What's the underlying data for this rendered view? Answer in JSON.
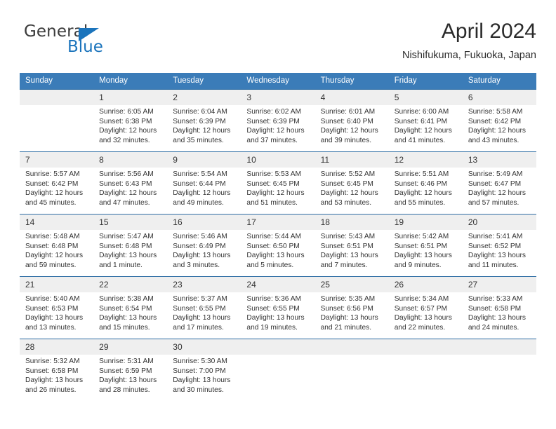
{
  "brand": {
    "name_top": "General",
    "name_bottom": "Blue",
    "accent_color": "#1b74bc"
  },
  "header": {
    "title": "April 2024",
    "location": "Nishifukuma, Fukuoka, Japan"
  },
  "calendar": {
    "header_bg": "#3b7cb8",
    "row_divider": "#2e6da4",
    "daynum_bg": "#efefef",
    "weekday_headers": [
      "Sunday",
      "Monday",
      "Tuesday",
      "Wednesday",
      "Thursday",
      "Friday",
      "Saturday"
    ],
    "weeks": [
      [
        {
          "day": "",
          "empty": true
        },
        {
          "day": "1",
          "sunrise": "Sunrise: 6:05 AM",
          "sunset": "Sunset: 6:38 PM",
          "daylight1": "Daylight: 12 hours",
          "daylight2": "and 32 minutes."
        },
        {
          "day": "2",
          "sunrise": "Sunrise: 6:04 AM",
          "sunset": "Sunset: 6:39 PM",
          "daylight1": "Daylight: 12 hours",
          "daylight2": "and 35 minutes."
        },
        {
          "day": "3",
          "sunrise": "Sunrise: 6:02 AM",
          "sunset": "Sunset: 6:39 PM",
          "daylight1": "Daylight: 12 hours",
          "daylight2": "and 37 minutes."
        },
        {
          "day": "4",
          "sunrise": "Sunrise: 6:01 AM",
          "sunset": "Sunset: 6:40 PM",
          "daylight1": "Daylight: 12 hours",
          "daylight2": "and 39 minutes."
        },
        {
          "day": "5",
          "sunrise": "Sunrise: 6:00 AM",
          "sunset": "Sunset: 6:41 PM",
          "daylight1": "Daylight: 12 hours",
          "daylight2": "and 41 minutes."
        },
        {
          "day": "6",
          "sunrise": "Sunrise: 5:58 AM",
          "sunset": "Sunset: 6:42 PM",
          "daylight1": "Daylight: 12 hours",
          "daylight2": "and 43 minutes."
        }
      ],
      [
        {
          "day": "7",
          "sunrise": "Sunrise: 5:57 AM",
          "sunset": "Sunset: 6:42 PM",
          "daylight1": "Daylight: 12 hours",
          "daylight2": "and 45 minutes."
        },
        {
          "day": "8",
          "sunrise": "Sunrise: 5:56 AM",
          "sunset": "Sunset: 6:43 PM",
          "daylight1": "Daylight: 12 hours",
          "daylight2": "and 47 minutes."
        },
        {
          "day": "9",
          "sunrise": "Sunrise: 5:54 AM",
          "sunset": "Sunset: 6:44 PM",
          "daylight1": "Daylight: 12 hours",
          "daylight2": "and 49 minutes."
        },
        {
          "day": "10",
          "sunrise": "Sunrise: 5:53 AM",
          "sunset": "Sunset: 6:45 PM",
          "daylight1": "Daylight: 12 hours",
          "daylight2": "and 51 minutes."
        },
        {
          "day": "11",
          "sunrise": "Sunrise: 5:52 AM",
          "sunset": "Sunset: 6:45 PM",
          "daylight1": "Daylight: 12 hours",
          "daylight2": "and 53 minutes."
        },
        {
          "day": "12",
          "sunrise": "Sunrise: 5:51 AM",
          "sunset": "Sunset: 6:46 PM",
          "daylight1": "Daylight: 12 hours",
          "daylight2": "and 55 minutes."
        },
        {
          "day": "13",
          "sunrise": "Sunrise: 5:49 AM",
          "sunset": "Sunset: 6:47 PM",
          "daylight1": "Daylight: 12 hours",
          "daylight2": "and 57 minutes."
        }
      ],
      [
        {
          "day": "14",
          "sunrise": "Sunrise: 5:48 AM",
          "sunset": "Sunset: 6:48 PM",
          "daylight1": "Daylight: 12 hours",
          "daylight2": "and 59 minutes."
        },
        {
          "day": "15",
          "sunrise": "Sunrise: 5:47 AM",
          "sunset": "Sunset: 6:48 PM",
          "daylight1": "Daylight: 13 hours",
          "daylight2": "and 1 minute."
        },
        {
          "day": "16",
          "sunrise": "Sunrise: 5:46 AM",
          "sunset": "Sunset: 6:49 PM",
          "daylight1": "Daylight: 13 hours",
          "daylight2": "and 3 minutes."
        },
        {
          "day": "17",
          "sunrise": "Sunrise: 5:44 AM",
          "sunset": "Sunset: 6:50 PM",
          "daylight1": "Daylight: 13 hours",
          "daylight2": "and 5 minutes."
        },
        {
          "day": "18",
          "sunrise": "Sunrise: 5:43 AM",
          "sunset": "Sunset: 6:51 PM",
          "daylight1": "Daylight: 13 hours",
          "daylight2": "and 7 minutes."
        },
        {
          "day": "19",
          "sunrise": "Sunrise: 5:42 AM",
          "sunset": "Sunset: 6:51 PM",
          "daylight1": "Daylight: 13 hours",
          "daylight2": "and 9 minutes."
        },
        {
          "day": "20",
          "sunrise": "Sunrise: 5:41 AM",
          "sunset": "Sunset: 6:52 PM",
          "daylight1": "Daylight: 13 hours",
          "daylight2": "and 11 minutes."
        }
      ],
      [
        {
          "day": "21",
          "sunrise": "Sunrise: 5:40 AM",
          "sunset": "Sunset: 6:53 PM",
          "daylight1": "Daylight: 13 hours",
          "daylight2": "and 13 minutes."
        },
        {
          "day": "22",
          "sunrise": "Sunrise: 5:38 AM",
          "sunset": "Sunset: 6:54 PM",
          "daylight1": "Daylight: 13 hours",
          "daylight2": "and 15 minutes."
        },
        {
          "day": "23",
          "sunrise": "Sunrise: 5:37 AM",
          "sunset": "Sunset: 6:55 PM",
          "daylight1": "Daylight: 13 hours",
          "daylight2": "and 17 minutes."
        },
        {
          "day": "24",
          "sunrise": "Sunrise: 5:36 AM",
          "sunset": "Sunset: 6:55 PM",
          "daylight1": "Daylight: 13 hours",
          "daylight2": "and 19 minutes."
        },
        {
          "day": "25",
          "sunrise": "Sunrise: 5:35 AM",
          "sunset": "Sunset: 6:56 PM",
          "daylight1": "Daylight: 13 hours",
          "daylight2": "and 21 minutes."
        },
        {
          "day": "26",
          "sunrise": "Sunrise: 5:34 AM",
          "sunset": "Sunset: 6:57 PM",
          "daylight1": "Daylight: 13 hours",
          "daylight2": "and 22 minutes."
        },
        {
          "day": "27",
          "sunrise": "Sunrise: 5:33 AM",
          "sunset": "Sunset: 6:58 PM",
          "daylight1": "Daylight: 13 hours",
          "daylight2": "and 24 minutes."
        }
      ],
      [
        {
          "day": "28",
          "sunrise": "Sunrise: 5:32 AM",
          "sunset": "Sunset: 6:58 PM",
          "daylight1": "Daylight: 13 hours",
          "daylight2": "and 26 minutes."
        },
        {
          "day": "29",
          "sunrise": "Sunrise: 5:31 AM",
          "sunset": "Sunset: 6:59 PM",
          "daylight1": "Daylight: 13 hours",
          "daylight2": "and 28 minutes."
        },
        {
          "day": "30",
          "sunrise": "Sunrise: 5:30 AM",
          "sunset": "Sunset: 7:00 PM",
          "daylight1": "Daylight: 13 hours",
          "daylight2": "and 30 minutes."
        },
        {
          "day": "",
          "empty": true
        },
        {
          "day": "",
          "empty": true
        },
        {
          "day": "",
          "empty": true
        },
        {
          "day": "",
          "empty": true
        }
      ]
    ]
  }
}
